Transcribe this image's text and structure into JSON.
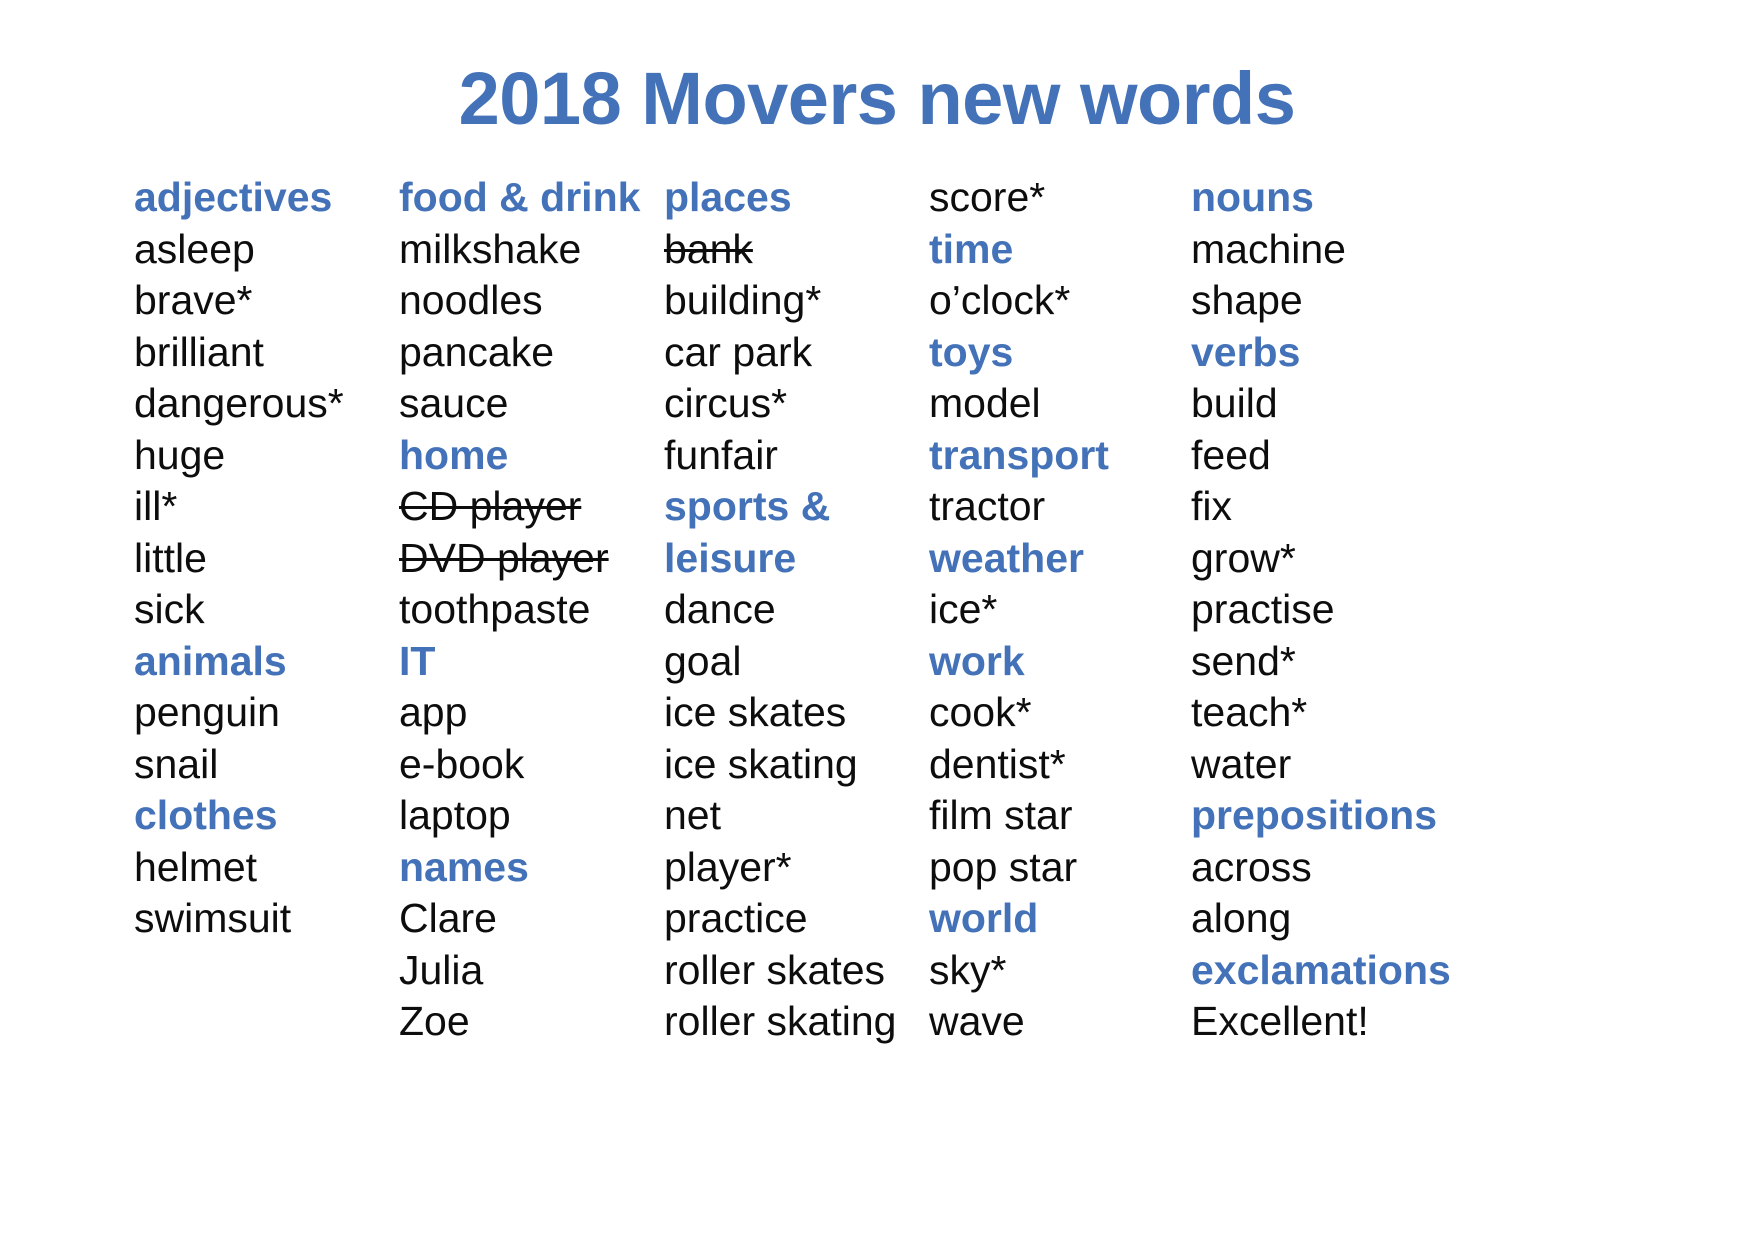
{
  "title": "2018 Movers new words",
  "accent_color": "#4472b8",
  "body_color": "#0d0d0d",
  "background_color": "#ffffff",
  "columns": [
    {
      "index": 0,
      "entries": [
        {
          "text": "adjectives",
          "kind": "heading"
        },
        {
          "text": "asleep",
          "kind": "word"
        },
        {
          "text": "brave*",
          "kind": "word"
        },
        {
          "text": "brilliant",
          "kind": "word"
        },
        {
          "text": "dangerous*",
          "kind": "word"
        },
        {
          "text": "huge",
          "kind": "word"
        },
        {
          "text": "ill*",
          "kind": "word"
        },
        {
          "text": "little",
          "kind": "word"
        },
        {
          "text": "sick",
          "kind": "word"
        },
        {
          "text": "animals",
          "kind": "heading"
        },
        {
          "text": "penguin",
          "kind": "word"
        },
        {
          "text": "snail",
          "kind": "word"
        },
        {
          "text": "clothes",
          "kind": "heading"
        },
        {
          "text": "helmet",
          "kind": "word"
        },
        {
          "text": "swimsuit",
          "kind": "word"
        }
      ]
    },
    {
      "index": 1,
      "entries": [
        {
          "text": "food & drink",
          "kind": "heading"
        },
        {
          "text": "milkshake",
          "kind": "word"
        },
        {
          "text": "noodles",
          "kind": "word"
        },
        {
          "text": "pancake",
          "kind": "word"
        },
        {
          "text": "sauce",
          "kind": "word"
        },
        {
          "text": "home",
          "kind": "heading"
        },
        {
          "text": "CD player",
          "kind": "word",
          "struck": true
        },
        {
          "text": "DVD player",
          "kind": "word",
          "struck": true
        },
        {
          "text": "toothpaste",
          "kind": "word"
        },
        {
          "text": "IT",
          "kind": "heading"
        },
        {
          "text": "app",
          "kind": "word"
        },
        {
          "text": "e-book",
          "kind": "word"
        },
        {
          "text": "laptop",
          "kind": "word"
        },
        {
          "text": "names",
          "kind": "heading"
        },
        {
          "text": "Clare",
          "kind": "word"
        },
        {
          "text": "Julia",
          "kind": "word"
        },
        {
          "text": "Zoe",
          "kind": "word"
        }
      ]
    },
    {
      "index": 2,
      "entries": [
        {
          "text": "places",
          "kind": "heading"
        },
        {
          "text": "bank",
          "kind": "word",
          "struck": true
        },
        {
          "text": "building*",
          "kind": "word"
        },
        {
          "text": "car park",
          "kind": "word"
        },
        {
          "text": "circus*",
          "kind": "word"
        },
        {
          "text": "funfair",
          "kind": "word"
        },
        {
          "text": "sports &",
          "kind": "heading"
        },
        {
          "text": "leisure",
          "kind": "heading"
        },
        {
          "text": "dance",
          "kind": "word"
        },
        {
          "text": "goal",
          "kind": "word"
        },
        {
          "text": "ice skates",
          "kind": "word"
        },
        {
          "text": "ice skating",
          "kind": "word"
        },
        {
          "text": "net",
          "kind": "word"
        },
        {
          "text": "player*",
          "kind": "word"
        },
        {
          "text": "practice",
          "kind": "word"
        },
        {
          "text": "roller skates",
          "kind": "word"
        },
        {
          "text": "roller skating",
          "kind": "word"
        }
      ]
    },
    {
      "index": 3,
      "entries": [
        {
          "text": "score*",
          "kind": "word"
        },
        {
          "text": "time",
          "kind": "heading"
        },
        {
          "text": "o’clock*",
          "kind": "word"
        },
        {
          "text": "toys",
          "kind": "heading"
        },
        {
          "text": "model",
          "kind": "word"
        },
        {
          "text": "transport",
          "kind": "heading"
        },
        {
          "text": "tractor",
          "kind": "word"
        },
        {
          "text": "weather",
          "kind": "heading"
        },
        {
          "text": "ice*",
          "kind": "word"
        },
        {
          "text": "work",
          "kind": "heading"
        },
        {
          "text": "cook*",
          "kind": "word"
        },
        {
          "text": "dentist*",
          "kind": "word"
        },
        {
          "text": "film star",
          "kind": "word"
        },
        {
          "text": "pop star",
          "kind": "word"
        },
        {
          "text": "world",
          "kind": "heading"
        },
        {
          "text": "sky*",
          "kind": "word"
        },
        {
          "text": "wave",
          "kind": "word"
        }
      ]
    },
    {
      "index": 4,
      "entries": [
        {
          "text": "nouns",
          "kind": "heading"
        },
        {
          "text": "machine",
          "kind": "word"
        },
        {
          "text": "shape",
          "kind": "word"
        },
        {
          "text": "verbs",
          "kind": "heading"
        },
        {
          "text": "build",
          "kind": "word"
        },
        {
          "text": "feed",
          "kind": "word"
        },
        {
          "text": "fix",
          "kind": "word"
        },
        {
          "text": "grow*",
          "kind": "word"
        },
        {
          "text": "practise",
          "kind": "word"
        },
        {
          "text": "send*",
          "kind": "word"
        },
        {
          "text": "teach*",
          "kind": "word"
        },
        {
          "text": "water",
          "kind": "word"
        },
        {
          "text": "prepositions",
          "kind": "heading"
        },
        {
          "text": "across",
          "kind": "word"
        },
        {
          "text": "along",
          "kind": "word"
        },
        {
          "text": "exclamations",
          "kind": "heading"
        },
        {
          "text": "Excellent!",
          "kind": "word"
        }
      ]
    }
  ]
}
